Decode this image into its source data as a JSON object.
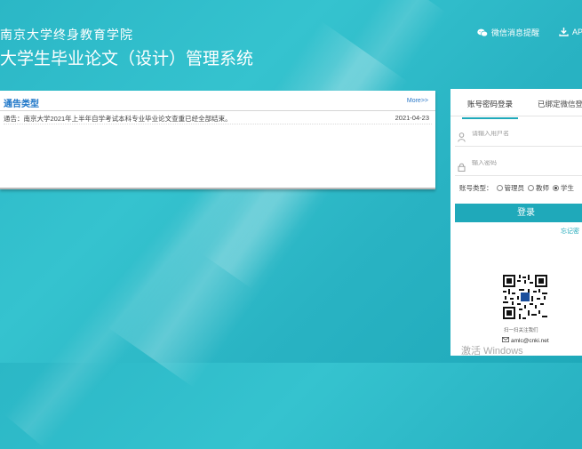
{
  "header": {
    "school_name": "南京大学终身教育学院",
    "system_title": "大学生毕业论文（设计）管理系统"
  },
  "top_links": {
    "wechat_label": "微信消息提醒",
    "app_label": "AP"
  },
  "notice": {
    "title": "通告类型",
    "more": "More>>",
    "items": [
      {
        "text": "通告：南京大学2021年上半年自学考试本科专业毕业论文查重已经全部结束。",
        "date": "2021-04-23"
      }
    ]
  },
  "login": {
    "tab_password": "账号密码登录",
    "tab_wechat": "已绑定微信登",
    "username_placeholder": "请输入用户名",
    "password_placeholder": "输入密码",
    "account_type_label": "账号类型：",
    "roles": [
      {
        "label": "管理员",
        "selected": false
      },
      {
        "label": "教师",
        "selected": false
      },
      {
        "label": "学生",
        "selected": true
      }
    ],
    "login_button": "登录",
    "forgot": "忘记密",
    "qr_caption": "扫一扫关注我们",
    "email": "amlc@cnki.net"
  },
  "watermark": "激活 Windows",
  "colors": {
    "accent": "#1fa9ba",
    "link": "#1a74c7"
  }
}
